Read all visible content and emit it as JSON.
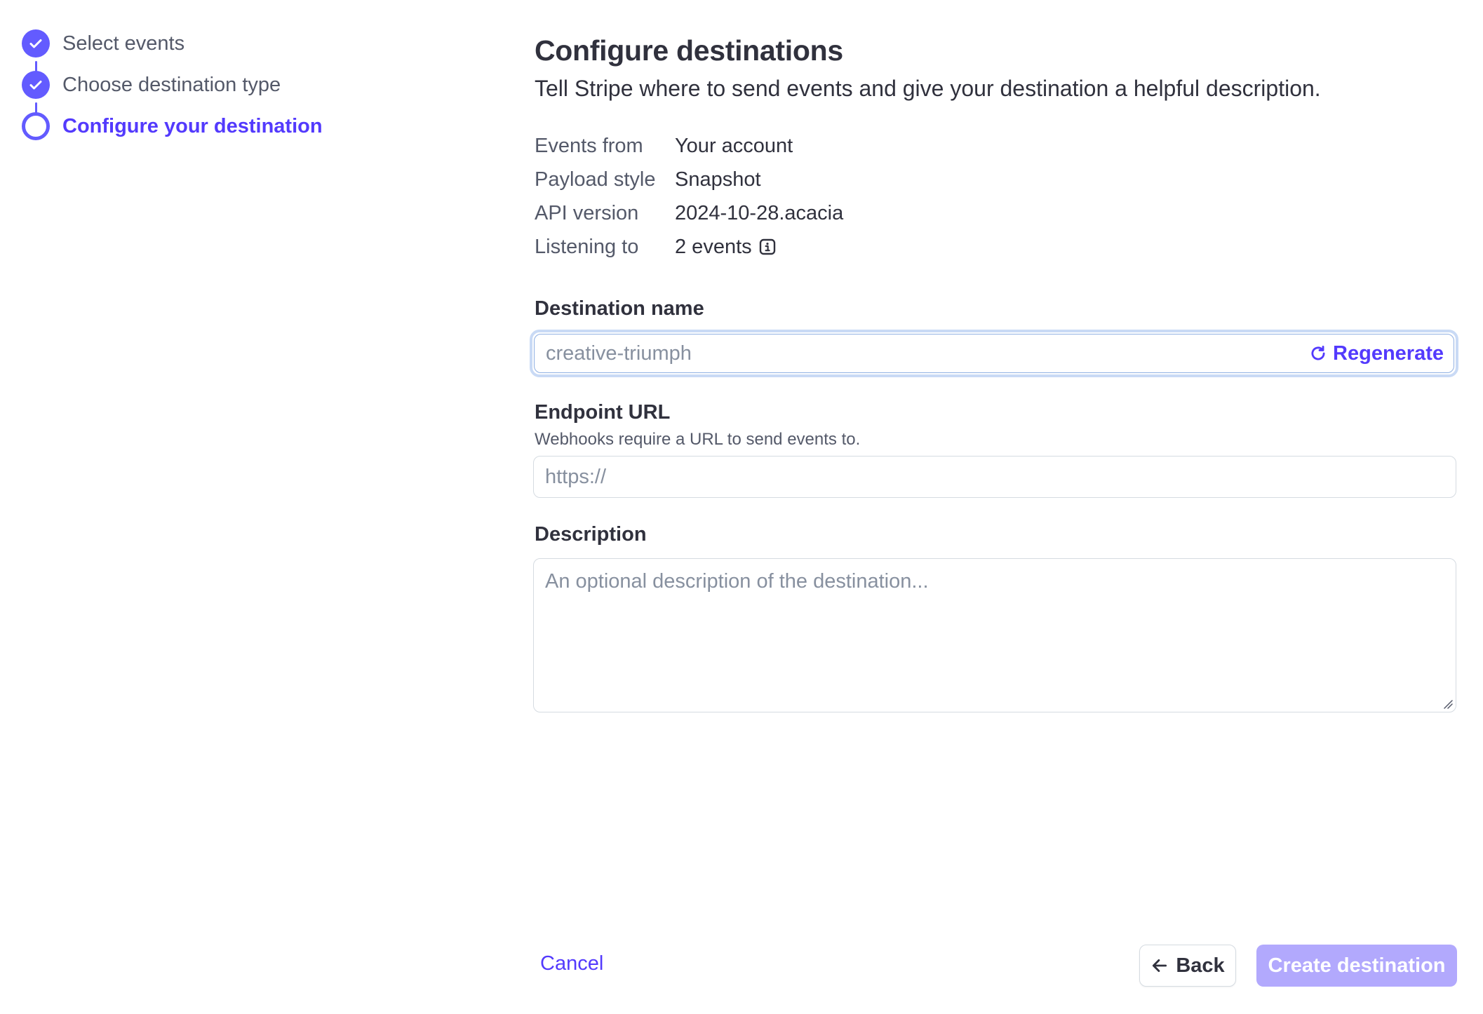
{
  "stepper": {
    "steps": [
      {
        "label": "Select events",
        "state": "done",
        "icon": "check-icon"
      },
      {
        "label": "Choose destination type",
        "state": "done",
        "icon": "check-icon"
      },
      {
        "label": "Configure your destination",
        "state": "current",
        "icon": "ring-icon"
      }
    ]
  },
  "header": {
    "title": "Configure destinations",
    "subtitle": "Tell Stripe where to send events and give your destination a helpful description."
  },
  "summary": {
    "events_from": {
      "label": "Events from",
      "value": "Your account"
    },
    "payload_style": {
      "label": "Payload style",
      "value": "Snapshot"
    },
    "api_version": {
      "label": "API version",
      "value": "2024-10-28.acacia"
    },
    "listening_to": {
      "label": "Listening to",
      "value": "2 events",
      "icon": "info-icon"
    }
  },
  "form": {
    "destination_name": {
      "label": "Destination name",
      "value": "",
      "placeholder": "creative-triumph",
      "regenerate_label": "Regenerate",
      "regenerate_icon": "refresh-icon"
    },
    "endpoint_url": {
      "label": "Endpoint URL",
      "help": "Webhooks require a URL to send events to.",
      "value": "",
      "placeholder": "https://"
    },
    "description": {
      "label": "Description",
      "value": "",
      "placeholder": "An optional description of the destination..."
    }
  },
  "footer": {
    "cancel_label": "Cancel",
    "back_label": "Back",
    "back_icon": "arrow-left-icon",
    "create_label": "Create destination"
  },
  "colors": {
    "accent": "#533afd",
    "stepper": "#635bff",
    "create_disabled": "#b2a9fd",
    "focus_ring": "#c9daf5"
  }
}
